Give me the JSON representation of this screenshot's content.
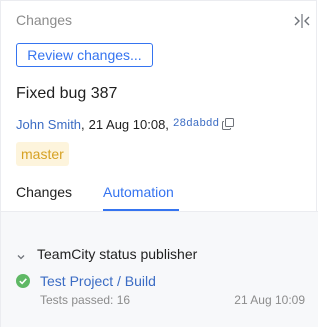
{
  "panel": {
    "title": "Changes",
    "collapse_icon": "collapse-panel-icon"
  },
  "review_button": {
    "label": "Review changes..."
  },
  "commit": {
    "title": "Fixed bug 387",
    "author": "John Smith",
    "separator": ",",
    "date": "21 Aug 10:08,",
    "hash": "28dabdd",
    "copy_icon": "copy-icon",
    "branch": "master"
  },
  "tabs": [
    {
      "label": "Changes",
      "selected": false
    },
    {
      "label": "Automation",
      "selected": true
    }
  ],
  "automation": {
    "section_label": "TeamCity status publisher",
    "expanded": true,
    "build": {
      "name": "Test Project / Build",
      "status": "success",
      "tests_summary": "Tests passed: 16",
      "date": "21 Aug 10:09"
    }
  },
  "colors": {
    "accent": "#3574f0",
    "link": "#3b6cc4",
    "branch_text": "#d6a224",
    "branch_bg": "#fdf4dc",
    "success": "#5fb865",
    "content_bg": "#f7f8fa"
  }
}
